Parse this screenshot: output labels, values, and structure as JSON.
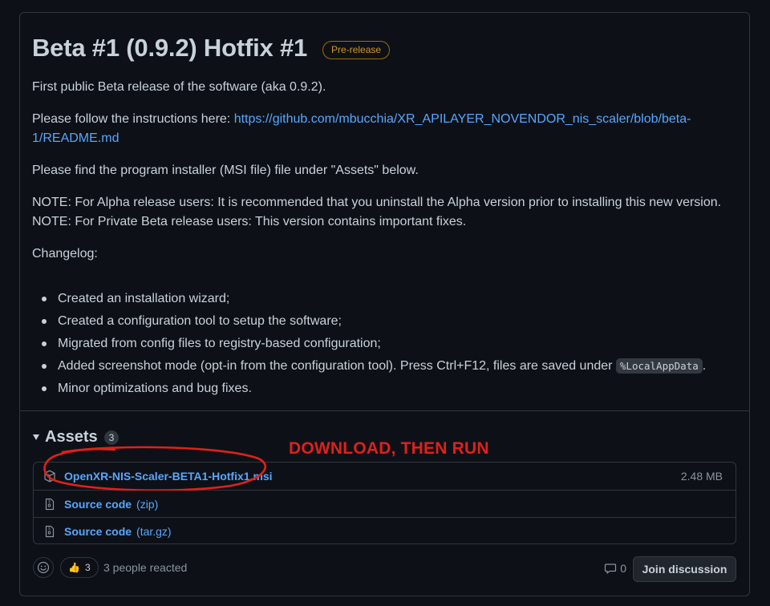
{
  "release": {
    "title": "Beta #1 (0.9.2) Hotfix #1",
    "badge": "Pre-release"
  },
  "body": {
    "p1": "First public Beta release of the software (aka 0.9.2).",
    "p2_prefix": "Please follow the instructions here: ",
    "p2_link_line1": "https://github.com/mbucchia/XR_APILAYER_NOVENDOR_nis_scaler/blob/beta-",
    "p2_link_line2": "1/README.md",
    "p3": "Please find the program installer (MSI file) file under \"Assets\" below.",
    "note1": "NOTE: For Alpha release users: It is recommended that you uninstall the Alpha version prior to installing this new version.",
    "note2": "NOTE: For Private Beta release users: This version contains important fixes.",
    "changelog_label": "Changelog:",
    "changelog": [
      "Created an installation wizard;",
      "Created a configuration tool to setup the software;",
      "Migrated from config files to registry-based configuration;",
      "Added screenshot mode (opt-in from the configuration tool). Press Ctrl+F12, files are saved under ",
      "Minor optimizations and bug fixes."
    ],
    "changelog_code": "%LocalAppData",
    "changelog_code_suffix": "."
  },
  "assets": {
    "label": "Assets",
    "count": "3",
    "annotation": "DOWNLOAD, THEN RUN",
    "annotation_color": "#e0201b",
    "items": [
      {
        "name": "OpenXR-NIS-Scaler-BETA1-Hotfix1.msi",
        "suffix": "",
        "size": "2.48 MB",
        "icon": "package-icon"
      },
      {
        "name": "Source code",
        "suffix": "(zip)",
        "size": "",
        "icon": "file-zip-icon"
      },
      {
        "name": "Source code",
        "suffix": "(tar.gz)",
        "size": "",
        "icon": "file-zip-icon"
      }
    ]
  },
  "footer": {
    "reaction_emoji": "👍",
    "reaction_count": "3",
    "reacted_text": "3 people reacted",
    "comment_count": "0",
    "join_label": "Join discussion"
  },
  "colors": {
    "background": "#0d1117",
    "link": "#58a6ff",
    "badge": "#d29922",
    "border": "#30363d"
  }
}
